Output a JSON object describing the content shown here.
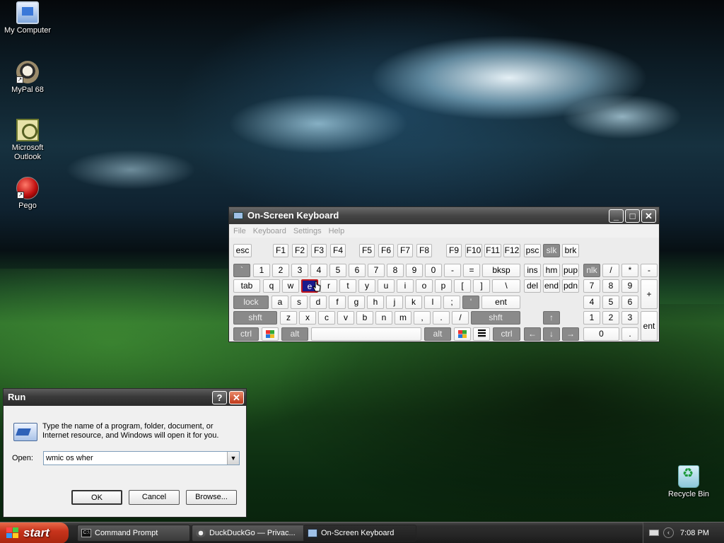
{
  "desktop": {
    "icons": [
      {
        "label": "My Computer",
        "icon": "computer-icon"
      },
      {
        "label": "MyPal 68",
        "icon": "mypal-icon"
      },
      {
        "label": "Microsoft Outlook",
        "icon": "outlook-icon"
      },
      {
        "label": "Pego",
        "icon": "pego-icon"
      },
      {
        "label": "Recycle Bin",
        "icon": "recycle-bin-icon"
      }
    ]
  },
  "osk": {
    "title": "On-Screen Keyboard",
    "menu": [
      "File",
      "Keyboard",
      "Settings",
      "Help"
    ],
    "selected_key": "e",
    "keys": {
      "esc": "esc",
      "f1": "F1",
      "f2": "F2",
      "f3": "F3",
      "f4": "F4",
      "f5": "F5",
      "f6": "F6",
      "f7": "F7",
      "f8": "F8",
      "f9": "F9",
      "f10": "F10",
      "f11": "F11",
      "f12": "F12",
      "psc": "psc",
      "slk": "slk",
      "brk": "brk",
      "grave": "`",
      "n1": "1",
      "n2": "2",
      "n3": "3",
      "n4": "4",
      "n5": "5",
      "n6": "6",
      "n7": "7",
      "n8": "8",
      "n9": "9",
      "n0": "0",
      "minus": "-",
      "equals": "=",
      "bksp": "bksp",
      "ins": "ins",
      "hm": "hm",
      "pup": "pup",
      "nlk": "nlk",
      "np_div": "/",
      "np_mul": "*",
      "np_sub": "-",
      "tab": "tab",
      "q": "q",
      "w": "w",
      "e": "e",
      "r": "r",
      "t": "t",
      "y": "y",
      "u": "u",
      "i": "i",
      "o": "o",
      "p": "p",
      "lbr": "[",
      "rbr": "]",
      "bslash": "\\",
      "del": "del",
      "end": "end",
      "pdn": "pdn",
      "np7": "7",
      "np8": "8",
      "np9": "9",
      "np_add": "+",
      "lock": "lock",
      "a": "a",
      "s": "s",
      "d": "d",
      "f": "f",
      "g": "g",
      "h": "h",
      "j": "j",
      "k": "k",
      "l": "l",
      "semi": ";",
      "quote": "'",
      "ent": "ent",
      "np4": "4",
      "np5": "5",
      "np6": "6",
      "lshft": "shft",
      "z": "z",
      "x": "x",
      "c": "c",
      "v": "v",
      "b": "b",
      "n": "n",
      "m": "m",
      "comma": ",",
      "period": ".",
      "slash": "/",
      "rshft": "shft",
      "up": "↑",
      "np1": "1",
      "np2": "2",
      "np3": "3",
      "np_ent": "ent",
      "lctrl": "ctrl",
      "lalt": "alt",
      "space": "",
      "ralt": "alt",
      "rctrl": "ctrl",
      "left": "←",
      "down": "↓",
      "right": "→",
      "np0": "0",
      "np_dot": "."
    }
  },
  "run": {
    "title": "Run",
    "description": "Type the name of a program, folder, document, or Internet resource, and Windows will open it for you.",
    "open_label": "Open:",
    "input_value": "wmic os wher",
    "ok": "OK",
    "cancel": "Cancel",
    "browse": "Browse..."
  },
  "taskbar": {
    "start": "start",
    "tasks": [
      {
        "label": "Command Prompt",
        "icon": "cmd-icon"
      },
      {
        "label": "DuckDuckGo — Privac...",
        "icon": "mypal-icon"
      },
      {
        "label": "On-Screen Keyboard",
        "icon": "keyboard-icon"
      }
    ],
    "clock": "7:08 PM"
  }
}
